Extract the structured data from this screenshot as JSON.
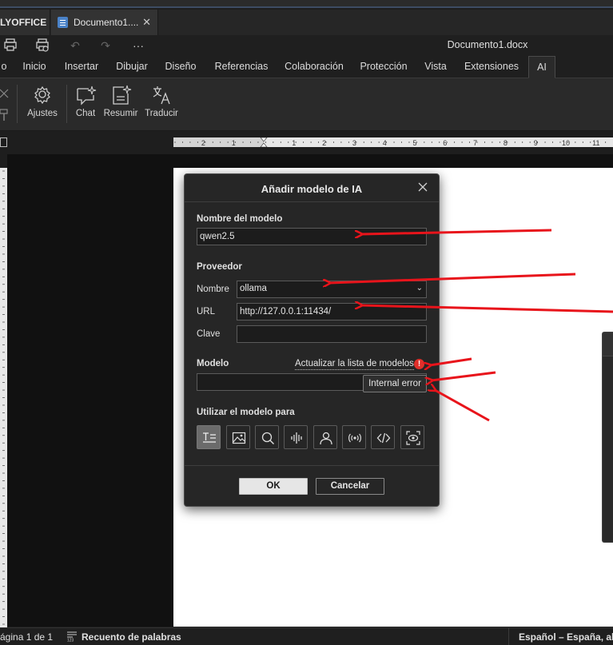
{
  "app": {
    "name_tab": "LYOFFICE",
    "doc_tab": "Documento1....",
    "doc_title": "Documento1.docx"
  },
  "ribbon_tabs": [
    "o",
    "Inicio",
    "Insertar",
    "Dibujar",
    "Diseño",
    "Referencias",
    "Colaboración",
    "Protección",
    "Vista",
    "Extensiones",
    "AI"
  ],
  "ribbon": {
    "settings": "Ajustes",
    "chat": "Chat",
    "summarize": "Resumir",
    "translate": "Traducir"
  },
  "ruler_numbers": [
    "2",
    "1",
    "1",
    "2",
    "3",
    "4",
    "5",
    "6",
    "7",
    "8",
    "9",
    "10",
    "11"
  ],
  "dialog": {
    "title": "Añadir modelo de IA",
    "model_name_label": "Nombre del modelo",
    "model_name_value": "qwen2.5",
    "provider_label": "Proveedor",
    "name_label": "Nombre",
    "name_value": "ollama",
    "url_label": "URL",
    "url_value": "http://127.0.0.1:11434/",
    "key_label": "Clave",
    "key_value": "",
    "model_label": "Modelo",
    "refresh_link": "Actualizar la lista de modelos",
    "error_icon": "!",
    "tooltip": "Internal error",
    "use_for_label": "Utilizar el modelo para",
    "capabilities": [
      "text-icon",
      "image-icon",
      "search-icon",
      "audio-icon",
      "person-icon",
      "broadcast-icon",
      "code-icon",
      "vision-icon"
    ],
    "ok": "OK",
    "cancel": "Cancelar"
  },
  "status": {
    "page": "ágina 1 de 1",
    "word_count": "Recuento de palabras",
    "language": "Español – España, alfa"
  },
  "colors": {
    "annotation_arrow": "#e8141b",
    "page": "#ffffff",
    "dialog_bg": "#262626"
  }
}
